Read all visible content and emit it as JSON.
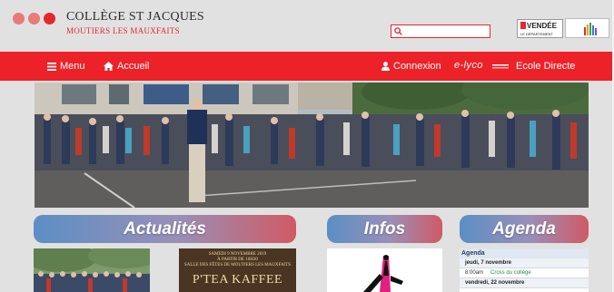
{
  "brand": {
    "name": "COLLÈGE ST JACQUES",
    "subtitle": "MOUTIERS LES MAUXFAITS"
  },
  "search": {
    "placeholder": ""
  },
  "logos": {
    "vendee": "VENDÉE",
    "vendee_sub": "LE DÉPARTEMENT"
  },
  "nav": {
    "menu_label": "Menu",
    "home_label": "Accueil",
    "login_label": "Connexion",
    "elyco_label": "e-lyco",
    "ecole_directe_label": "Ecole Directe"
  },
  "sections": {
    "news_title": "Actualités",
    "info_title": "Infos",
    "agenda_title": "Agenda"
  },
  "news_thumb2": {
    "line1": "SAMEDI 9 NOVEMBRE 2019",
    "line2": "À PARTIR DE 10H30",
    "line3": "SALLE DES FÊTES DE MOUTIERS LES MAUXFAITS",
    "line4": "P'TEA KAFFEE"
  },
  "agenda": {
    "header": "Agenda",
    "days": [
      {
        "date": "jeudi, 7 novembre",
        "events": [
          {
            "time": "8:00am",
            "title": "Cross du collège"
          }
        ]
      },
      {
        "date": "vendredi, 22 novembre",
        "events": []
      }
    ]
  },
  "colors": {
    "accent_red": "#ed2228",
    "pill_blue": "#5b8fc4",
    "pill_red": "#d05a64"
  },
  "icons": {
    "menu": "hamburger-icon",
    "home": "home-icon",
    "login": "user-icon",
    "search": "search-icon"
  }
}
